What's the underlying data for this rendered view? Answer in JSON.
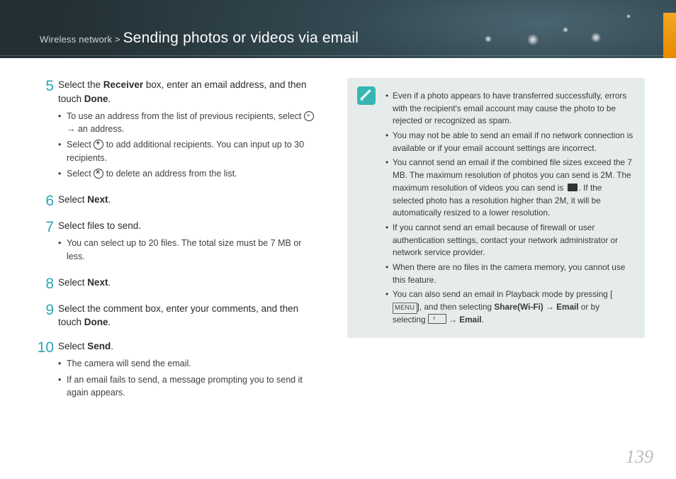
{
  "header": {
    "crumb_prefix": "Wireless network > ",
    "crumb_title": "Sending photos or videos via email"
  },
  "steps": {
    "s5": {
      "num": "5",
      "text_a": "Select the ",
      "text_b": "Receiver",
      "text_c": " box, enter an email address, and then touch ",
      "text_d": "Done",
      "text_e": ".",
      "bul1_a": "To use an address from the list of previous recipients, select ",
      "bul1_b": " → an address.",
      "bul2_a": "Select ",
      "bul2_b": " to add additional recipients. You can input up to 30 recipients.",
      "bul3_a": "Select ",
      "bul3_b": " to delete an address from the list."
    },
    "s6": {
      "num": "6",
      "text_a": "Select ",
      "text_b": "Next",
      "text_c": "."
    },
    "s7": {
      "num": "7",
      "text": "Select files to send.",
      "bul1": "You can select up to 20 files. The total size must be 7 MB or less."
    },
    "s8": {
      "num": "8",
      "text_a": "Select ",
      "text_b": "Next",
      "text_c": "."
    },
    "s9": {
      "num": "9",
      "text_a": "Select the comment box, enter your comments, and then touch ",
      "text_b": "Done",
      "text_c": "."
    },
    "s10": {
      "num": "10",
      "text_a": "Select ",
      "text_b": "Send",
      "text_c": ".",
      "bul1": "The camera will send the email.",
      "bul2": "If an email fails to send, a message prompting you to send it again appears."
    }
  },
  "notes": {
    "n1": "Even if a photo appears to have transferred successfully, errors with the recipient's email account may cause the photo to be rejected or recognized as spam.",
    "n2": "You may not be able to send an email if no network connection is available or if your email account settings are incorrect.",
    "n3_a": "You cannot send an email if the combined file sizes exceed the 7 MB. The maximum resolution of photos you can send is 2M. The maximum resolution of videos you can send is ",
    "n3_b": ". If the selected photo has a resolution higher than 2M, it will be automatically resized to a lower resolution.",
    "n4": "If you cannot send an email because of firewall or user authentication settings, contact your network administrator or network service provider.",
    "n5": "When there are no files in the camera memory, you cannot use this feature.",
    "n6_a": "You can also send an email in Playback mode by pressing [",
    "n6_menu": "MENU",
    "n6_b": "], and then selecting ",
    "n6_c": "Share(Wi-Fi)",
    "n6_d": " → ",
    "n6_e": "Email",
    "n6_f": " or by selecting ",
    "n6_g": " → ",
    "n6_h": "Email",
    "n6_i": "."
  },
  "page_number": "139"
}
